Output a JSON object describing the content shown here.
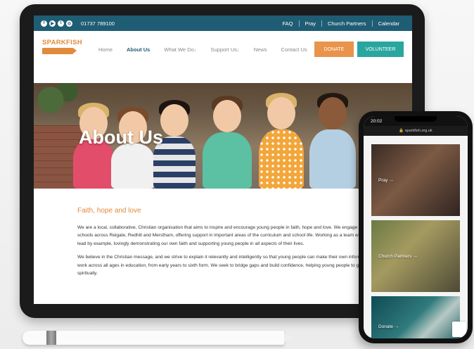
{
  "topbar": {
    "social_icons": [
      "facebook-icon",
      "youtube-icon",
      "twitter-icon",
      "instagram-icon"
    ],
    "phone": "01737 789100",
    "links": [
      "FAQ",
      "Pray",
      "Church Partners",
      "Calendar"
    ]
  },
  "logo": {
    "text": "SPARKFISH"
  },
  "nav": {
    "items": [
      "Home",
      "About Us",
      "What We Do",
      "Support Us",
      "News",
      "Contact Us"
    ],
    "active": "About Us",
    "donate_label": "DONATE",
    "volunteer_label": "VOLUNTEER"
  },
  "hero": {
    "title": "About Us"
  },
  "content": {
    "heading": "Faith, hope and love",
    "paragraphs": [
      "We are a local, collaborative, Christian organisation that aims to inspire and encourage young people in faith, hope and love. We engage with young people in schools across Reigate, Redhill and Merstham, offering support in important areas of the curriculum and school life. Working as a team with local churches, we lead by example, lovingly demonstrating our own faith and supporting young people in all aspects of their lives.",
      "We believe in the Christian message, and we strive to explain it relevantly and intelligently so that young people can make their own informed response. We work across all ages in education, from early years to sixth form. We seek to bridge gaps and build confidence, helping young people to grow emotionally and spiritually."
    ]
  },
  "phone": {
    "time": "20:02",
    "url": "sparkfish.org.uk",
    "tiles": [
      "Pray",
      "Church Partners",
      "Donate"
    ]
  },
  "colors": {
    "primary": "#1f5d74",
    "accent": "#e28a3c",
    "teal": "#2aa6a0"
  }
}
